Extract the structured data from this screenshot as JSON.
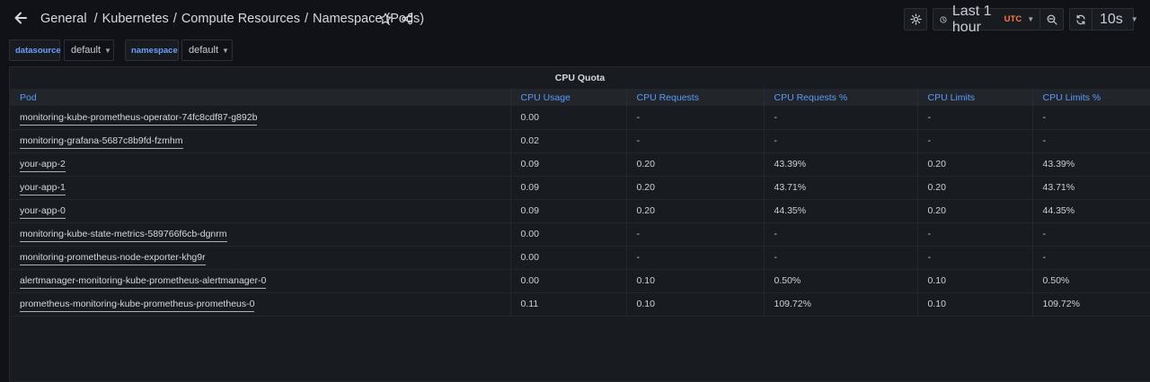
{
  "header": {
    "breadcrumb": [
      "General",
      "Kubernetes",
      "Compute Resources",
      "Namespace (Pods)"
    ],
    "separator": "/",
    "time_range": "Last 1 hour",
    "timezone": "UTC",
    "refresh_interval": "10s"
  },
  "variables": [
    {
      "label": "datasource",
      "value": "default"
    },
    {
      "label": "namespace",
      "value": "default"
    }
  ],
  "panel": {
    "title": "CPU Quota",
    "columns": [
      "Pod",
      "CPU Usage",
      "CPU Requests",
      "CPU Requests %",
      "CPU Limits",
      "CPU Limits %"
    ],
    "rows": [
      [
        "monitoring-kube-prometheus-operator-74fc8cdf87-g892b",
        "0.00",
        "-",
        "-",
        "-",
        "-"
      ],
      [
        "monitoring-grafana-5687c8b9fd-fzmhm",
        "0.02",
        "-",
        "-",
        "-",
        "-"
      ],
      [
        "your-app-2",
        "0.09",
        "0.20",
        "43.39%",
        "0.20",
        "43.39%"
      ],
      [
        "your-app-1",
        "0.09",
        "0.20",
        "43.71%",
        "0.20",
        "43.71%"
      ],
      [
        "your-app-0",
        "0.09",
        "0.20",
        "44.35%",
        "0.20",
        "44.35%"
      ],
      [
        "monitoring-kube-state-metrics-589766f6cb-dgnrm",
        "0.00",
        "-",
        "-",
        "-",
        "-"
      ],
      [
        "monitoring-prometheus-node-exporter-khg9r",
        "0.00",
        "-",
        "-",
        "-",
        "-"
      ],
      [
        "alertmanager-monitoring-kube-prometheus-alertmanager-0",
        "0.00",
        "0.10",
        "0.50%",
        "0.10",
        "0.50%"
      ],
      [
        "prometheus-monitoring-kube-prometheus-prometheus-0",
        "0.11",
        "0.10",
        "109.72%",
        "0.10",
        "109.72%"
      ]
    ]
  },
  "colors": {
    "background": "#111217",
    "panel": "#181b1f",
    "header_text": "#5a9cf8",
    "variable_label": "#6e9fff",
    "utc": "#ff7941"
  },
  "icons": [
    "arrow-left-icon",
    "star-icon",
    "share-icon",
    "gear-icon",
    "clock-icon",
    "chevron-down-icon",
    "zoom-out-icon",
    "refresh-icon"
  ]
}
